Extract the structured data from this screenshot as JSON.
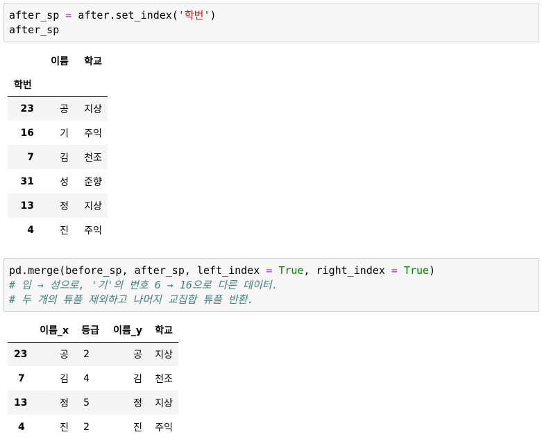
{
  "cell1": {
    "line1": {
      "a": "after_sp ",
      "op": "=",
      "b": " after.set_index(",
      "s": "'학번'",
      "c": ")"
    },
    "line2": "after_sp"
  },
  "table1": {
    "columns": [
      "이름",
      "학교"
    ],
    "index_name": "학번",
    "rows": [
      {
        "idx": "23",
        "name": "공",
        "school": "지상"
      },
      {
        "idx": "16",
        "name": "기",
        "school": "주익"
      },
      {
        "idx": "7",
        "name": "김",
        "school": "천조"
      },
      {
        "idx": "31",
        "name": "성",
        "school": "준향"
      },
      {
        "idx": "13",
        "name": "정",
        "school": "지상"
      },
      {
        "idx": "4",
        "name": "진",
        "school": "주익"
      }
    ]
  },
  "cell2": {
    "line1": {
      "a": "pd.merge(before_sp, after_sp, left_index ",
      "op1": "=",
      "b": " ",
      "t1": "True",
      "c": ", right_index ",
      "op2": "=",
      "d": " ",
      "t2": "True",
      "e": ")"
    },
    "comment1": "# 임 → 성으로, '기'의 번호 6 → 16으로 다른 데이터.",
    "comment2": "# 두 개의 튜플 제외하고 나머지 교집합 튜플 반환."
  },
  "table2": {
    "columns": [
      "이름_x",
      "등급",
      "이름_y",
      "학교"
    ],
    "rows": [
      {
        "idx": "23",
        "name_x": "공",
        "grade": "2",
        "name_y": "공",
        "school": "지상"
      },
      {
        "idx": "7",
        "name_x": "김",
        "grade": "4",
        "name_y": "김",
        "school": "천조"
      },
      {
        "idx": "13",
        "name_x": "정",
        "grade": "5",
        "name_y": "정",
        "school": "지상"
      },
      {
        "idx": "4",
        "name_x": "진",
        "grade": "2",
        "name_y": "진",
        "school": "주익"
      }
    ]
  }
}
